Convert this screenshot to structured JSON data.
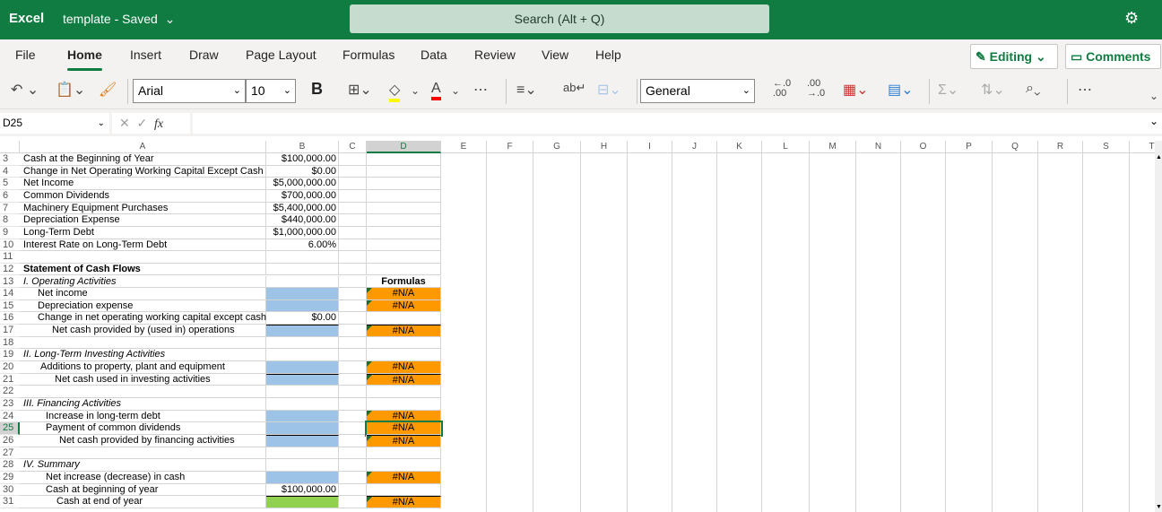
{
  "titlebar": {
    "app": "Excel",
    "doc": "template - Saved",
    "search_placeholder": "Search (Alt + Q)"
  },
  "tabs": [
    "File",
    "Home",
    "Insert",
    "Draw",
    "Page Layout",
    "Formulas",
    "Data",
    "Review",
    "View",
    "Help"
  ],
  "active_tab": "Home",
  "ribbon_buttons": {
    "editing": "Editing",
    "comments": "Comments"
  },
  "toolbar": {
    "font": "Arial",
    "size": "10",
    "number_format": "General",
    "bold": "B"
  },
  "formula_bar": {
    "name_box": "D25",
    "fx": "fx",
    "value": ""
  },
  "columns": [
    "A",
    "B",
    "C",
    "D",
    "E",
    "F",
    "G",
    "H",
    "I",
    "J",
    "K",
    "L",
    "M",
    "N",
    "O",
    "P",
    "Q",
    "R",
    "S",
    "T"
  ],
  "selected_cell": "D25",
  "colors": {
    "brand": "#107c41",
    "input_blue": "#9dc3e6",
    "formula_orange": "#ff9900",
    "result_green": "#92d050"
  },
  "rows": [
    {
      "n": "3",
      "a": "Cash at the Beginning of Year",
      "b": "$100,000.00",
      "d": ""
    },
    {
      "n": "4",
      "a": "Change in Net Operating Working Capital Except Cash",
      "b": "$0.00",
      "d": ""
    },
    {
      "n": "5",
      "a": "Net Income",
      "b": "$5,000,000.00",
      "d": ""
    },
    {
      "n": "6",
      "a": "Common Dividends",
      "b": "$700,000.00",
      "d": ""
    },
    {
      "n": "7",
      "a": "Machinery Equipment Purchases",
      "b": "$5,400,000.00",
      "d": ""
    },
    {
      "n": "8",
      "a": "Depreciation Expense",
      "b": "$440,000.00",
      "d": ""
    },
    {
      "n": "9",
      "a": "Long-Term Debt",
      "b": "$1,000,000.00",
      "d": ""
    },
    {
      "n": "10",
      "a": "Interest Rate on Long-Term Debt",
      "b": "6.00%",
      "d": ""
    },
    {
      "n": "11",
      "a": "",
      "b": "",
      "d": ""
    },
    {
      "n": "12",
      "a": "Statement of Cash Flows",
      "b": "",
      "d": "",
      "bold": true
    },
    {
      "n": "13",
      "a": "I.  Operating Activities",
      "b": "",
      "d": "Formulas",
      "italic": true
    },
    {
      "n": "14",
      "a": "Net income",
      "b": "",
      "d": "#N/A",
      "indent": 16,
      "bfill": "blue",
      "dfill": true
    },
    {
      "n": "15",
      "a": "Depreciation expense",
      "b": "",
      "d": "#N/A",
      "indent": 16,
      "bfill": "blue",
      "dfill": true
    },
    {
      "n": "16",
      "a": "Change in net operating working capital except cash",
      "b": "$0.00",
      "d": "",
      "indent": 16
    },
    {
      "n": "17",
      "a": "Net cash provided by (used in) operations",
      "b": "",
      "d": "#N/A",
      "indent": 32,
      "bfill": "blue",
      "dfill": true,
      "total": true
    },
    {
      "n": "18",
      "a": "",
      "b": "",
      "d": ""
    },
    {
      "n": "19",
      "a": "II.  Long-Term Investing Activities",
      "b": "",
      "d": "",
      "italic": true
    },
    {
      "n": "20",
      "a": "Additions to property, plant and equipment",
      "b": "",
      "d": "#N/A",
      "indent": 19,
      "bfill": "blue",
      "dfill": true
    },
    {
      "n": "21",
      "a": "Net cash used in investing activities",
      "b": "",
      "d": "#N/A",
      "indent": 35,
      "bfill": "blue",
      "dfill": true,
      "total": true
    },
    {
      "n": "22",
      "a": "",
      "b": "",
      "d": ""
    },
    {
      "n": "23",
      "a": "III.  Financing Activities",
      "b": "",
      "d": "",
      "italic": true
    },
    {
      "n": "24",
      "a": "Increase in long-term debt",
      "b": "",
      "d": "#N/A",
      "indent": 25,
      "bfill": "blue",
      "dfill": true
    },
    {
      "n": "25",
      "a": "Payment of common dividends",
      "b": "",
      "d": "#N/A",
      "indent": 25,
      "bfill": "blue",
      "dfill": true,
      "selected": true
    },
    {
      "n": "26",
      "a": "Net cash provided by financing activities",
      "b": "",
      "d": "#N/A",
      "indent": 40,
      "bfill": "blue",
      "dfill": true,
      "total": true
    },
    {
      "n": "27",
      "a": "",
      "b": "",
      "d": ""
    },
    {
      "n": "28",
      "a": "IV.  Summary",
      "b": "",
      "d": "",
      "italic": true
    },
    {
      "n": "29",
      "a": "Net increase (decrease) in cash",
      "b": "",
      "d": "#N/A",
      "indent": 25,
      "bfill": "blue",
      "dfill": true
    },
    {
      "n": "30",
      "a": "Cash at beginning of year",
      "b": "$100,000.00",
      "d": "",
      "indent": 25
    },
    {
      "n": "31",
      "a": "Cash at end of year",
      "b": "",
      "d": "#N/A",
      "indent": 37,
      "bfill": "green",
      "dfill": true,
      "total": true
    }
  ]
}
